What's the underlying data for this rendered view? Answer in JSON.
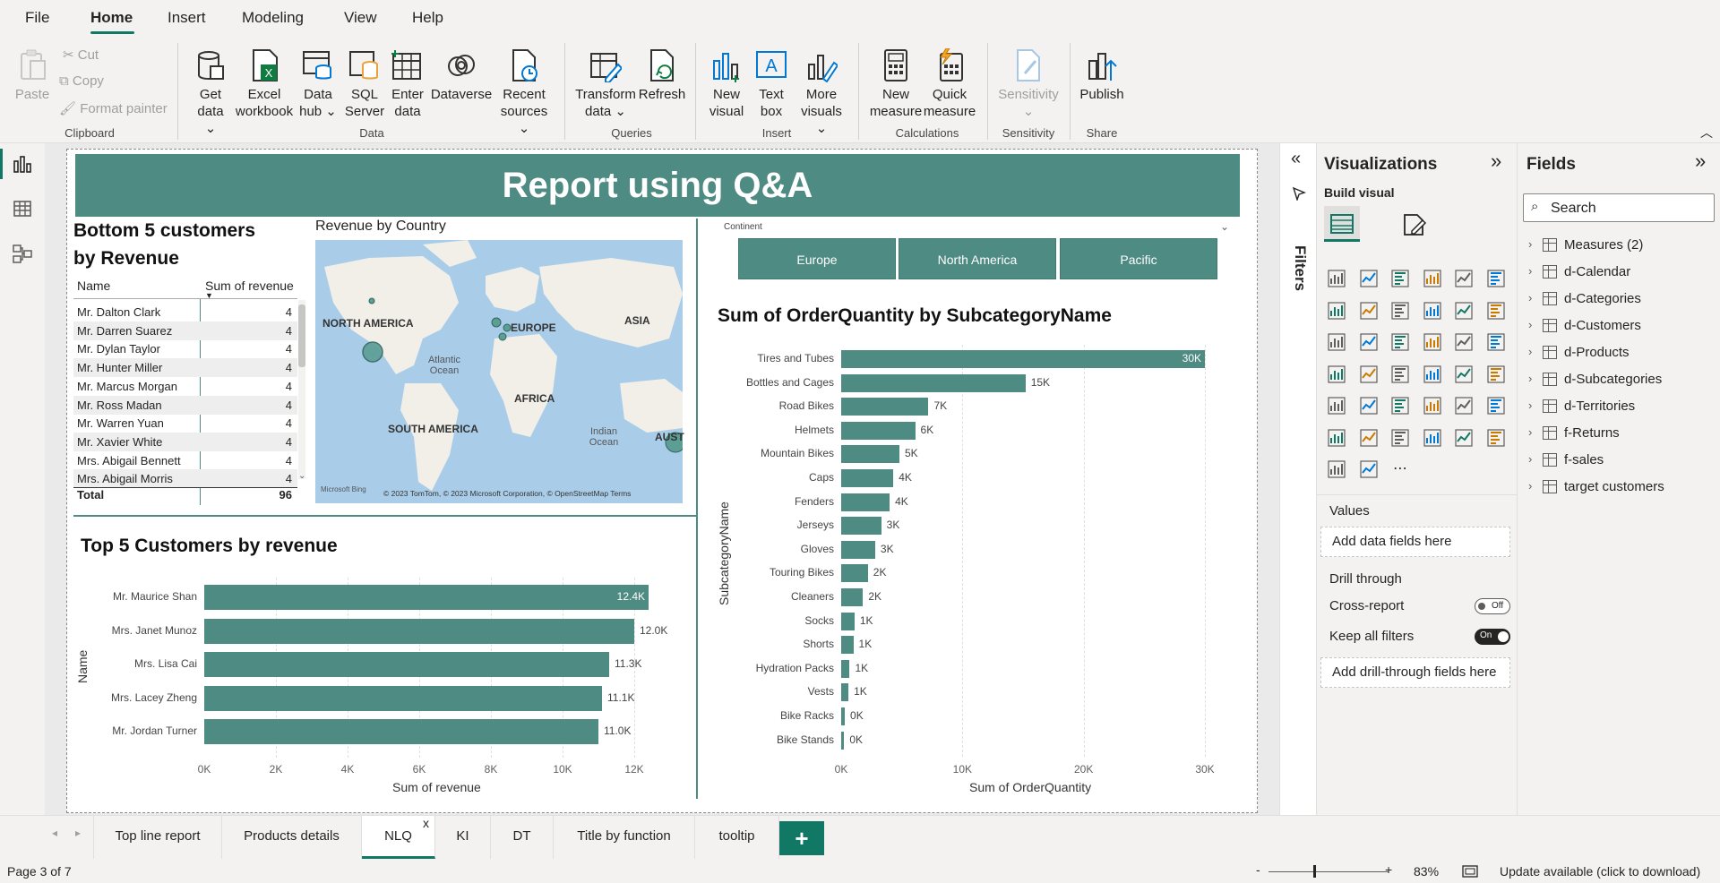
{
  "menu": {
    "items": [
      "File",
      "Home",
      "Insert",
      "Modeling",
      "View",
      "Help"
    ],
    "active": "Home"
  },
  "ribbon": {
    "clipboard": {
      "paste": "Paste",
      "cut": "Cut",
      "copy": "Copy",
      "format_painter": "Format painter",
      "group": "Clipboard"
    },
    "data": {
      "get_data": [
        "Get",
        "data"
      ],
      "excel": [
        "Excel",
        "workbook"
      ],
      "data_hub": [
        "Data",
        "hub"
      ],
      "sql": [
        "SQL",
        "Server"
      ],
      "enter": [
        "Enter",
        "data"
      ],
      "dataverse": "Dataverse",
      "recent": [
        "Recent",
        "sources"
      ],
      "group": "Data"
    },
    "queries": {
      "transform": [
        "Transform",
        "data"
      ],
      "refresh": "Refresh",
      "group": "Queries"
    },
    "insert": {
      "new_visual": [
        "New",
        "visual"
      ],
      "text_box": [
        "Text",
        "box"
      ],
      "more_visuals": [
        "More",
        "visuals"
      ],
      "group": "Insert"
    },
    "calculations": {
      "new_measure": [
        "New",
        "measure"
      ],
      "quick_measure": [
        "Quick",
        "measure"
      ],
      "group": "Calculations"
    },
    "sensitivity": {
      "label": "Sensitivity",
      "group": "Sensitivity"
    },
    "share": {
      "publish": "Publish",
      "group": "Share"
    }
  },
  "report": {
    "title": "Report using Q&A",
    "bottom5": {
      "title_line1": "Bottom 5 customers",
      "title_line2": "by Revenue",
      "col_name": "Name",
      "col_value": "Sum of revenue",
      "rows": [
        {
          "name": "Mr. Dalton Clark",
          "value": "4"
        },
        {
          "name": "Mr. Darren Suarez",
          "value": "4"
        },
        {
          "name": "Mr. Dylan Taylor",
          "value": "4"
        },
        {
          "name": "Mr. Hunter Miller",
          "value": "4"
        },
        {
          "name": "Mr. Marcus Morgan",
          "value": "4"
        },
        {
          "name": "Mr. Ross Madan",
          "value": "4"
        },
        {
          "name": "Mr. Warren Yuan",
          "value": "4"
        },
        {
          "name": "Mr. Xavier White",
          "value": "4"
        },
        {
          "name": "Mrs. Abigail Bennett",
          "value": "4"
        },
        {
          "name": "Mrs. Abigail Morris",
          "value": "4"
        }
      ],
      "total_label": "Total",
      "total_value": "96"
    },
    "map": {
      "title": "Revenue by Country",
      "labels": [
        "NORTH AMERICA",
        "EUROPE",
        "ASIA",
        "AFRICA",
        "SOUTH AMERICA",
        "AUST"
      ],
      "oceans": [
        "Atlantic Ocean",
        "Indian Ocean"
      ],
      "attribution": "© 2023 TomTom, © 2023 Microsoft Corporation, © OpenStreetMap  Terms",
      "bing": "Microsoft Bing"
    },
    "slicer": {
      "title": "Continent",
      "options": [
        "Europe",
        "North America",
        "Pacific"
      ]
    },
    "top5": {
      "title": "Top 5 Customers by revenue",
      "xlabel": "Sum of revenue",
      "ylabel": "Name",
      "ticks": [
        "0K",
        "2K",
        "4K",
        "6K",
        "8K",
        "10K",
        "12K"
      ]
    },
    "subcat": {
      "title": "Sum of OrderQuantity by SubcategoryName",
      "xlabel": "Sum of OrderQuantity",
      "ylabel": "SubcategoryName",
      "ticks": [
        "0K",
        "10K",
        "20K",
        "30K"
      ]
    }
  },
  "chart_data": [
    {
      "type": "bar",
      "title": "Top 5 Customers by revenue",
      "orientation": "horizontal",
      "categories": [
        "Mr. Maurice Shan",
        "Mrs. Janet Munoz",
        "Mrs. Lisa Cai",
        "Mrs. Lacey Zheng",
        "Mr. Jordan Turner"
      ],
      "values": [
        12400,
        12000,
        11300,
        11100,
        11000
      ],
      "labels": [
        "12.4K",
        "12.0K",
        "11.3K",
        "11.1K",
        "11.0K"
      ],
      "xlabel": "Sum of revenue",
      "ylabel": "Name",
      "xlim": [
        0,
        12000
      ]
    },
    {
      "type": "bar",
      "title": "Sum of OrderQuantity by SubcategoryName",
      "orientation": "horizontal",
      "categories": [
        "Tires and Tubes",
        "Bottles and Cages",
        "Road Bikes",
        "Helmets",
        "Mountain Bikes",
        "Caps",
        "Fenders",
        "Jerseys",
        "Gloves",
        "Touring Bikes",
        "Cleaners",
        "Socks",
        "Shorts",
        "Hydration Packs",
        "Vests",
        "Bike Racks",
        "Bike Stands"
      ],
      "values": [
        30000,
        15200,
        7200,
        6100,
        4800,
        4300,
        4000,
        3300,
        2800,
        2200,
        1800,
        1100,
        1000,
        700,
        600,
        300,
        250
      ],
      "labels": [
        "30K",
        "15K",
        "7K",
        "6K",
        "5K",
        "4K",
        "4K",
        "3K",
        "3K",
        "2K",
        "2K",
        "1K",
        "1K",
        "1K",
        "1K",
        "0K",
        "0K"
      ],
      "xlabel": "Sum of OrderQuantity",
      "ylabel": "SubcategoryName",
      "xlim": [
        0,
        30000
      ]
    }
  ],
  "filters": {
    "label": "Filters"
  },
  "visualizations": {
    "title": "Visualizations",
    "build_visual": "Build visual",
    "values_label": "Values",
    "values_placeholder": "Add data fields here",
    "drill_through": "Drill through",
    "cross_report": "Cross-report",
    "cross_report_state": "Off",
    "keep_all_filters": "Keep all filters",
    "keep_all_state": "On",
    "drill_placeholder": "Add drill-through fields here"
  },
  "fields": {
    "title": "Fields",
    "search_placeholder": "Search",
    "items": [
      "Measures (2)",
      "d-Calendar",
      "d-Categories",
      "d-Customers",
      "d-Products",
      "d-Subcategories",
      "d-Territories",
      "f-Returns",
      "f-sales",
      "target customers"
    ]
  },
  "tabs": {
    "items": [
      "Top line report",
      "Products details",
      "NLQ",
      "KI",
      "DT",
      "Title by function",
      "tooltip"
    ],
    "active": "NLQ",
    "close": "x",
    "add": "+"
  },
  "status": {
    "page": "Page 3 of 7",
    "zoom": "83%",
    "zoom_minus": "-",
    "zoom_plus": "+",
    "update": "Update available (click to download)"
  },
  "colors": {
    "accent": "#117865",
    "bar": "#4e8b82",
    "banner": "#4e8b82"
  }
}
